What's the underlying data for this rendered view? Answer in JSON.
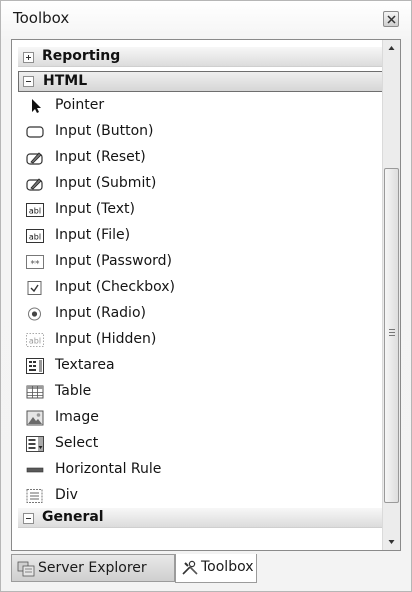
{
  "window": {
    "title": "Toolbox"
  },
  "categories": {
    "reporting": "Reporting",
    "html": "HTML",
    "general": "General"
  },
  "items": [
    {
      "label": "Pointer",
      "icon": "pointer-icon"
    },
    {
      "label": "Input (Button)",
      "icon": "button-icon"
    },
    {
      "label": "Input (Reset)",
      "icon": "reset-icon"
    },
    {
      "label": "Input (Submit)",
      "icon": "submit-icon"
    },
    {
      "label": "Input (Text)",
      "icon": "textbox-icon"
    },
    {
      "label": "Input (File)",
      "icon": "file-input-icon"
    },
    {
      "label": "Input (Password)",
      "icon": "password-icon"
    },
    {
      "label": "Input (Checkbox)",
      "icon": "checkbox-icon"
    },
    {
      "label": "Input (Radio)",
      "icon": "radio-icon"
    },
    {
      "label": "Input (Hidden)",
      "icon": "hidden-input-icon"
    },
    {
      "label": "Textarea",
      "icon": "textarea-icon"
    },
    {
      "label": "Table",
      "icon": "table-icon"
    },
    {
      "label": "Image",
      "icon": "image-icon"
    },
    {
      "label": "Select",
      "icon": "select-icon"
    },
    {
      "label": "Horizontal Rule",
      "icon": "horizontal-rule-icon"
    },
    {
      "label": "Div",
      "icon": "div-icon"
    }
  ],
  "icon_glyphs": {
    "textbox": "abl",
    "password": "**"
  },
  "tabs": {
    "server_explorer": "Server Explorer",
    "toolbox": "Toolbox"
  },
  "colors": {
    "category_bg": "#dcdcdc",
    "selected_border": "#6e6e6e",
    "window_border": "#b6b6b6"
  }
}
